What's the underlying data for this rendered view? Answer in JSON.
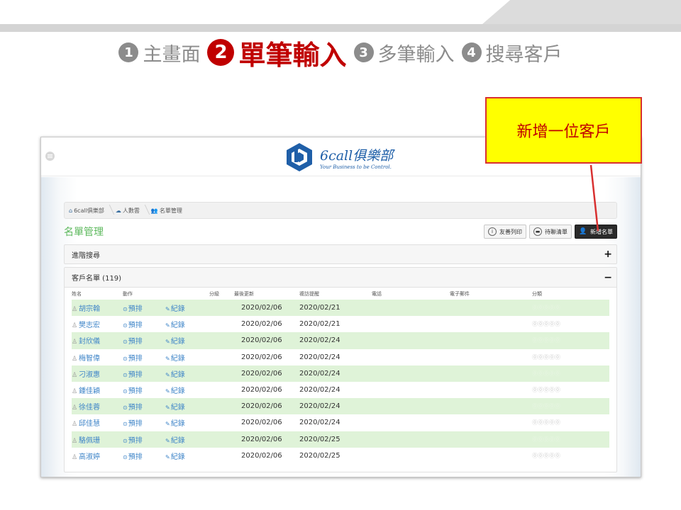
{
  "steps": [
    {
      "num": "1",
      "label": "主畫面"
    },
    {
      "num": "2",
      "label": "單筆輸入"
    },
    {
      "num": "3",
      "label": "多筆輸入"
    },
    {
      "num": "4",
      "label": "搜尋客戶"
    }
  ],
  "brand": {
    "name": "6call俱樂部",
    "slogan": "Your Business to be Control."
  },
  "breadcrumb": [
    "6call俱樂部",
    "人數雲",
    "名單管理"
  ],
  "page_title": "名單管理",
  "actions": [
    {
      "icon": "info-icon",
      "label": "友善列印"
    },
    {
      "icon": "folder-icon",
      "label": "待聯清單"
    },
    {
      "icon": "user-icon",
      "label": "新增名單"
    }
  ],
  "advanced_search": {
    "label": "進階搜尋",
    "toggle": "+"
  },
  "customer_list": {
    "label": "客戶名單 (119)",
    "toggle": "−"
  },
  "columns": [
    "姓名",
    "動作",
    "",
    "分級",
    "最後更新",
    "複訪提醒",
    "電話",
    "電子郵件",
    "分類"
  ],
  "action_labels": {
    "schedule": "預排",
    "record": "紀錄"
  },
  "rating_stars": "⓪⓪⓪⓪⓪",
  "rows": [
    {
      "name": "胡宗翰",
      "updated": "2020/02/06",
      "revisit": "2020/02/21"
    },
    {
      "name": "樊志宏",
      "updated": "2020/02/06",
      "revisit": "2020/02/21"
    },
    {
      "name": "封欣儀",
      "updated": "2020/02/06",
      "revisit": "2020/02/24"
    },
    {
      "name": "梅智偉",
      "updated": "2020/02/06",
      "revisit": "2020/02/24"
    },
    {
      "name": "刁淑惠",
      "updated": "2020/02/06",
      "revisit": "2020/02/24"
    },
    {
      "name": "鍾佳穎",
      "updated": "2020/02/06",
      "revisit": "2020/02/24"
    },
    {
      "name": "徐佳蓉",
      "updated": "2020/02/06",
      "revisit": "2020/02/24"
    },
    {
      "name": "邱佳慧",
      "updated": "2020/02/06",
      "revisit": "2020/02/24"
    },
    {
      "name": "駱佩珊",
      "updated": "2020/02/06",
      "revisit": "2020/02/25"
    },
    {
      "name": "高淑婷",
      "updated": "2020/02/06",
      "revisit": "2020/02/25"
    }
  ],
  "callout": {
    "text": "新增一位客戶"
  },
  "colors": {
    "active_step": "#c00000",
    "inactive_step": "#8c8c8c",
    "row_highlight": "#dff3d8",
    "callout_bg": "#ffff00",
    "callout_border": "#d83030",
    "title_green": "#5cb85c",
    "link_blue": "#3f85c8"
  }
}
